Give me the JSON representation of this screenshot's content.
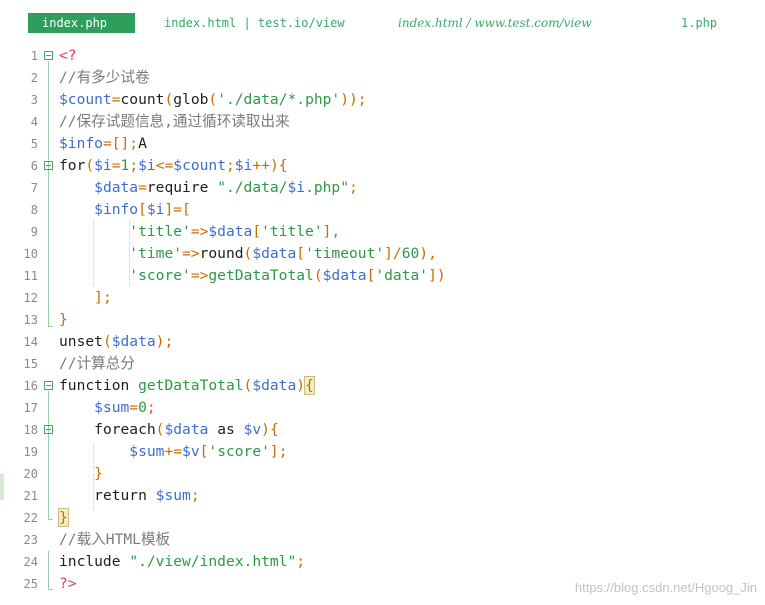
{
  "tabs": [
    {
      "label": "index.php",
      "active": true
    },
    {
      "label": "index.html | test.io/view",
      "active": false
    },
    {
      "label": "index.html / www.test.com/view",
      "active": false
    },
    {
      "label": "1.php",
      "active": false
    }
  ],
  "code_lines": [
    {
      "n": "1",
      "text": "<?"
    },
    {
      "n": "2",
      "text": "//有多少试卷"
    },
    {
      "n": "3",
      "text": "$count=count(glob('./data/*.php'));"
    },
    {
      "n": "4",
      "text": "//保存试题信息,通过循环读取出来"
    },
    {
      "n": "5",
      "text": "$info=[];A"
    },
    {
      "n": "6",
      "text": "for($i=1;$i<=$count;$i++){"
    },
    {
      "n": "7",
      "text": "    $data=require \"./data/$i.php\";"
    },
    {
      "n": "8",
      "text": "    $info[$i]=["
    },
    {
      "n": "9",
      "text": "        'title'=>$data['title'],"
    },
    {
      "n": "10",
      "text": "        'time'=>round($data['timeout']/60),"
    },
    {
      "n": "11",
      "text": "        'score'=>getDataTotal($data['data'])"
    },
    {
      "n": "12",
      "text": "    ];"
    },
    {
      "n": "13",
      "text": "}"
    },
    {
      "n": "14",
      "text": "unset($data);"
    },
    {
      "n": "15",
      "text": "//计算总分"
    },
    {
      "n": "16",
      "text": "function getDataTotal($data){"
    },
    {
      "n": "17",
      "text": "    $sum=0;"
    },
    {
      "n": "18",
      "text": "    foreach($data as $v){"
    },
    {
      "n": "19",
      "text": "        $sum+=$v['score'];"
    },
    {
      "n": "20",
      "text": "    }"
    },
    {
      "n": "21",
      "text": "    return $sum;"
    },
    {
      "n": "22",
      "text": "}"
    },
    {
      "n": "23",
      "text": "//载入HTML模板"
    },
    {
      "n": "24",
      "text": "include \"./view/index.html\";"
    },
    {
      "n": "25",
      "text": "?>"
    }
  ],
  "watermark": "https://blog.csdn.net/Hgoog_Jin",
  "colors": {
    "active_tab": "#2e9e5d",
    "tab_text": "#3aa867",
    "variable": "#3d6fd0",
    "string": "#2b9a44",
    "comment": "#7a7a7a",
    "php_tag": "#d3405b"
  }
}
